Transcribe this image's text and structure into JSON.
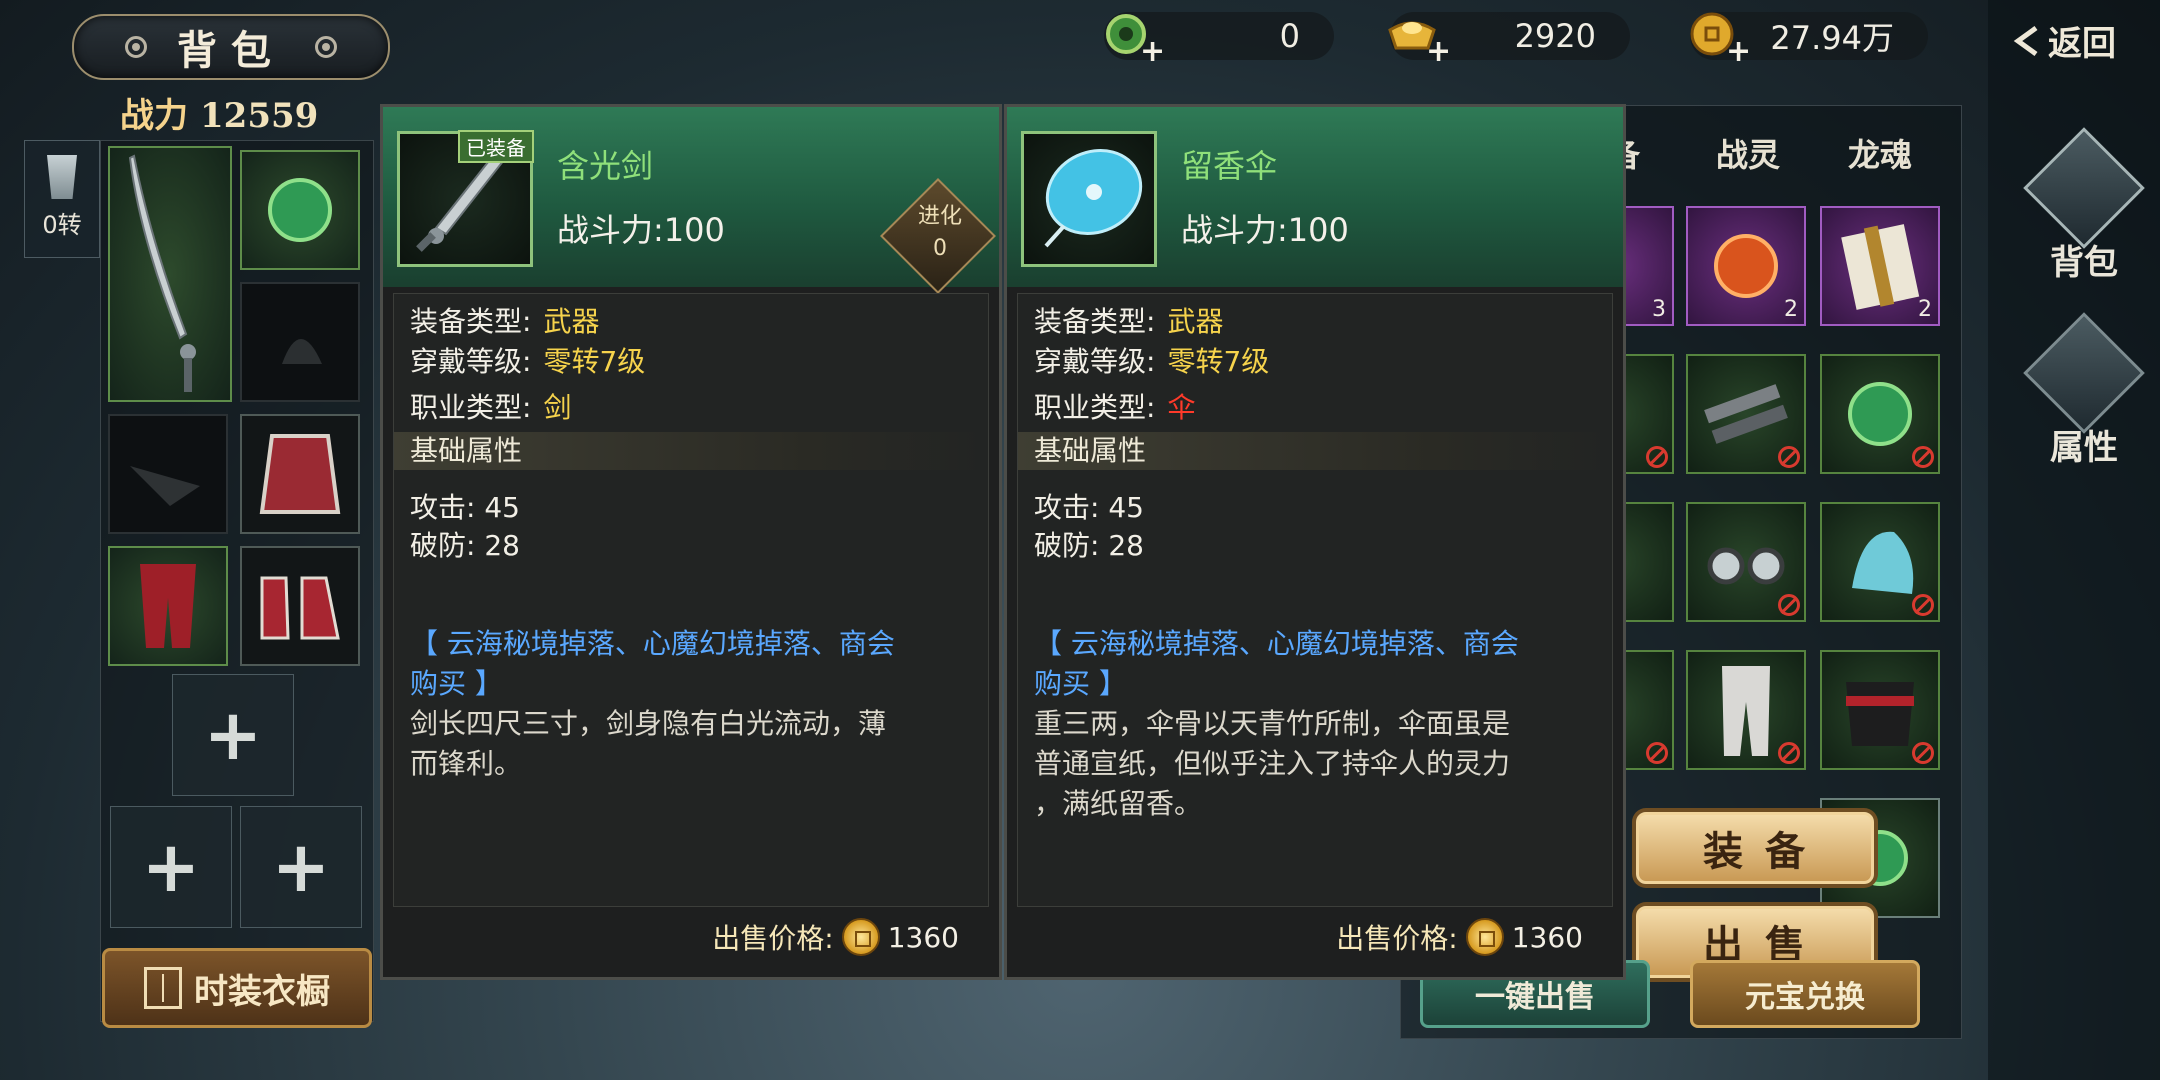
{
  "header": {
    "title": "背包",
    "power_label": "战力",
    "power_value": "12559",
    "back_label": "返回"
  },
  "currencies": [
    {
      "icon": "jade-dragon-icon",
      "value": "0"
    },
    {
      "icon": "gold-ingot-icon",
      "value": "2920"
    },
    {
      "icon": "copper-coin-icon",
      "value": "27.94万"
    }
  ],
  "rebirth": {
    "label": "0转"
  },
  "wardrobe_label": "时装衣橱",
  "nav": {
    "bag": "背包",
    "attributes": "属性"
  },
  "inventory": {
    "tabs": [
      "备",
      "战灵",
      "龙魂"
    ],
    "slots": [
      {
        "icon": "purple-gem-icon",
        "count": "3",
        "rarity": "purple"
      },
      {
        "icon": "pumpkin-charm-icon",
        "count": "2",
        "rarity": "purple"
      },
      {
        "icon": "scroll-book-icon",
        "count": "2",
        "rarity": "purple"
      },
      {
        "icon": "umbrella-icon",
        "restricted": true
      },
      {
        "icon": "gun-blade-icon",
        "restricted": true
      },
      {
        "icon": "jade-orb-icon",
        "restricted": true
      },
      {
        "icon": "orb-icon",
        "restricted": false
      },
      {
        "icon": "goggles-icon",
        "restricted": true
      },
      {
        "icon": "hood-icon",
        "restricted": true
      },
      {
        "icon": "boot-icon",
        "restricted": true
      },
      {
        "icon": "pants-icon",
        "restricted": true
      },
      {
        "icon": "belt-icon",
        "restricted": true
      }
    ],
    "equip_button": "装备",
    "sell_button": "出售",
    "bulk_sell": "一键出售",
    "exchange": "元宝兑换"
  },
  "tooltip_equipped": {
    "badge": "已装备",
    "name": "含光剑",
    "power": "战斗力:100",
    "evolve_label": "进化",
    "evolve_value": "0",
    "type_label": "装备类型:",
    "type_value": "武器",
    "level_label": "穿戴等级:",
    "level_value": "零转7级",
    "class_label": "职业类型:",
    "class_value": "剑",
    "section": "基础属性",
    "attack": "攻击: 45",
    "pierce": "破防: 28",
    "source_line1": "【 云海秘境掉落、心魔幻境掉落、商会",
    "source_line2": "购买 】",
    "desc_line1": "剑长四尺三寸，剑身隐有白光流动，薄",
    "desc_line2": "而锋利。",
    "price_label": "出售价格:",
    "price_value": "1360"
  },
  "tooltip_compare": {
    "name": "留香伞",
    "power": "战斗力:100",
    "type_label": "装备类型:",
    "type_value": "武器",
    "level_label": "穿戴等级:",
    "level_value": "零转7级",
    "class_label": "职业类型:",
    "class_value": "伞",
    "section": "基础属性",
    "attack": "攻击: 45",
    "pierce": "破防: 28",
    "source_line1": "【 云海秘境掉落、心魔幻境掉落、商会",
    "source_line2": "购买 】",
    "desc_line1": "重三两，伞骨以天青竹所制，伞面虽是",
    "desc_line2": "普通宣纸，但似乎注入了持伞人的灵力",
    "desc_line3": "，满纸留香。",
    "price_label": "出售价格:",
    "price_value": "1360"
  }
}
